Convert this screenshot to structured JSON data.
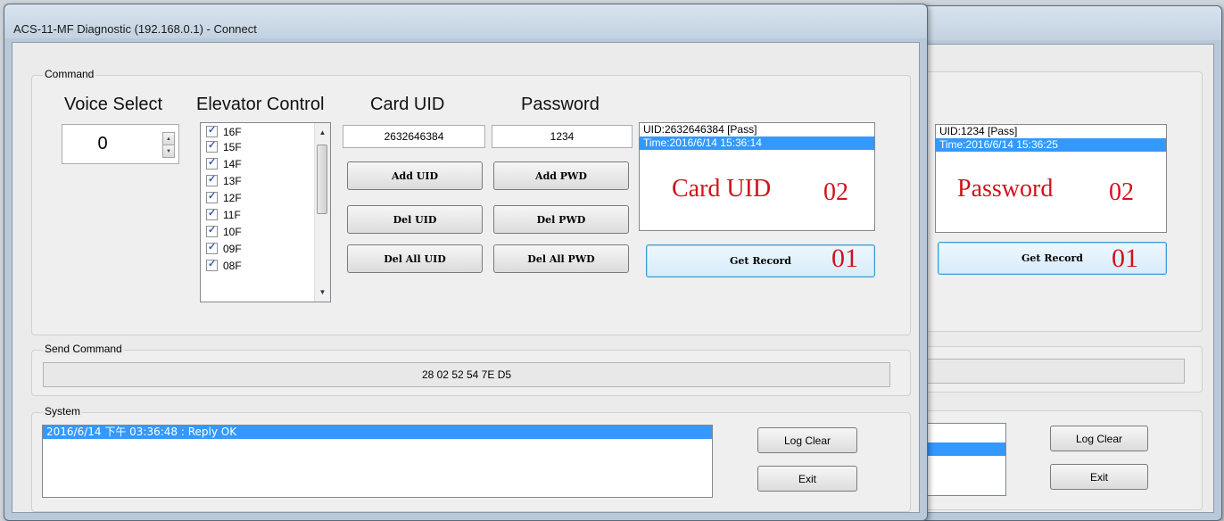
{
  "window_main": {
    "title": "ACS-11-MF Diagnostic (192.168.0.1) - Connect",
    "command_group": "Command",
    "labels": {
      "voice_select": "Voice Select",
      "elevator_control": "Elevator Control",
      "card_uid": "Card UID",
      "password": "Password"
    },
    "voice_value": "0",
    "floors": [
      "16F",
      "15F",
      "14F",
      "13F",
      "12F",
      "11F",
      "10F",
      "09F",
      "08F"
    ],
    "card_uid_value": "2632646384",
    "password_value": "1234",
    "buttons": {
      "add_uid": "Add UID",
      "add_pwd": "Add PWD",
      "del_uid": "Del UID",
      "del_pwd": "Del PWD",
      "del_all_uid": "Del All UID",
      "del_all_pwd": "Del All PWD",
      "get_record": "Get Record",
      "log_clear": "Log Clear",
      "exit": "Exit"
    },
    "record_list": [
      "UID:2632646384 [Pass]",
      "Time:2016/6/14 15:36:14"
    ],
    "annotation_main": "Card UID",
    "annotation_num": "02",
    "annotation_btn_num": "01",
    "send_group": "Send Command",
    "send_value": "28 02 52 54 7E D5",
    "system_group": "System",
    "log_items": [
      "2016/6/14 下午 03:36:48 : Reply OK"
    ]
  },
  "window_back": {
    "record_list": [
      "UID:1234 [Pass]",
      "Time:2016/6/14 15:36:25"
    ],
    "annotation_main": "Password",
    "annotation_num": "02",
    "annotation_btn_num": "01",
    "buttons": {
      "get_record": "Get Record",
      "log_clear": "Log Clear",
      "exit": "Exit"
    }
  }
}
